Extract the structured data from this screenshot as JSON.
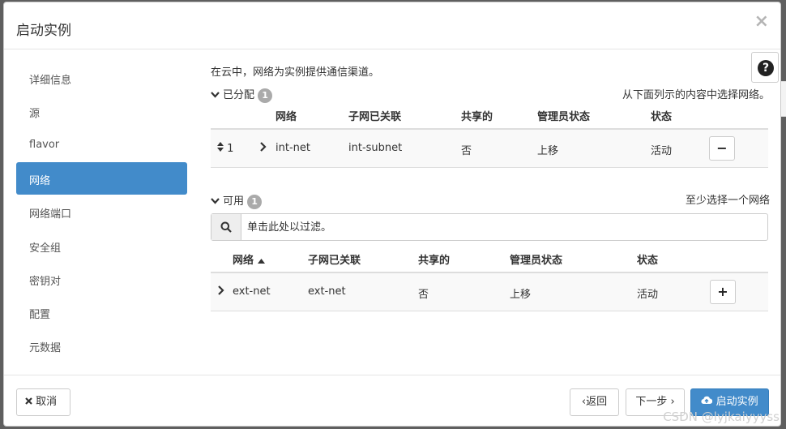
{
  "modal": {
    "title": "启动实例",
    "close_label": "×"
  },
  "sidebar": {
    "items": [
      {
        "label": "详细信息"
      },
      {
        "label": "源"
      },
      {
        "label": "flavor"
      },
      {
        "label": "网络",
        "active": true
      },
      {
        "label": "网络端口"
      },
      {
        "label": "安全组"
      },
      {
        "label": "密钥对"
      },
      {
        "label": "配置"
      },
      {
        "label": "元数据"
      }
    ]
  },
  "content": {
    "intro": "在云中，网络为实例提供通信渠道。",
    "help_label": "?",
    "allocated": {
      "title": "已分配",
      "count": "1",
      "hint": "从下面列示的内容中选择网络。",
      "columns": [
        "网络",
        "子网已关联",
        "共享的",
        "管理员状态",
        "状态"
      ],
      "rows": [
        {
          "order": "1",
          "network": "int-net",
          "subnet": "int-subnet",
          "shared": "否",
          "admin_state": "上移",
          "status": "活动",
          "action": "−"
        }
      ]
    },
    "available": {
      "title": "可用",
      "count": "1",
      "hint": "至少选择一个网络",
      "filter_placeholder": "单击此处以过滤。",
      "columns": [
        "网络",
        "子网已关联",
        "共享的",
        "管理员状态",
        "状态"
      ],
      "rows": [
        {
          "network": "ext-net",
          "subnet": "ext-net",
          "shared": "否",
          "admin_state": "上移",
          "status": "活动",
          "action": "+"
        }
      ]
    }
  },
  "footer": {
    "cancel_label": "取消",
    "back_label": "‹返回",
    "next_label": "下一步 ›",
    "launch_label": "启动实例"
  },
  "watermark": "CSDN @lyjkaiyyyss",
  "icons": {
    "close": "close-icon",
    "help": "question-circle-icon",
    "search": "search-icon",
    "sort": "sort-icon",
    "expand": "chevron-right-icon",
    "collapse": "chevron-down-icon",
    "cancel": "x-icon",
    "launch": "cloud-upload-icon"
  },
  "colors": {
    "primary": "#428bca",
    "badge": "#aaaaaa",
    "row_bg": "#f9f9f9"
  }
}
